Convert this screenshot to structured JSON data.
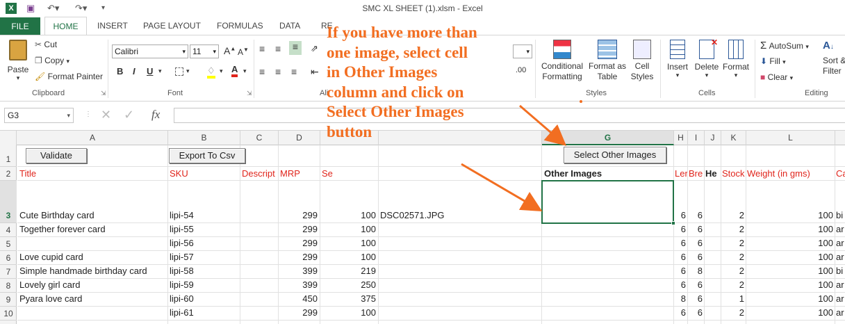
{
  "window": {
    "title": "SMC XL SHEET (1).xlsm - Excel"
  },
  "tabs": [
    "FILE",
    "HOME",
    "INSERT",
    "PAGE LAYOUT",
    "FORMULAS",
    "DATA",
    "RE"
  ],
  "ribbon": {
    "paste": "Paste",
    "cut": "Cut",
    "copy": "Copy",
    "format_painter": "Format Painter",
    "clipboard": "Clipboard",
    "font_name": "Calibri",
    "font_size": "11",
    "font": "Font",
    "alignment": "Ali",
    "conditional_formatting": "Conditional\nFormatting",
    "format_as_table": "Format as\nTable",
    "cell_styles": "Cell\nStyles",
    "styles": "Styles",
    "insert": "Insert",
    "delete": "Delete",
    "format": "Format",
    "cells": "Cells",
    "autosum": "AutoSum",
    "fill": "Fill",
    "clear": "Clear",
    "sort_filter": "Sort &\nFilter",
    "editing": "Editing"
  },
  "formula_bar": {
    "name_box": "G3",
    "fx": "fx",
    "value": ""
  },
  "columns": [
    "A",
    "B",
    "C",
    "D",
    "E",
    "F",
    "G",
    "H",
    "I",
    "J",
    "K",
    "L",
    "M"
  ],
  "column_labels": {
    "A": "A",
    "B": "B",
    "C": "C",
    "D": "D",
    "G": "G",
    "H": "H",
    "I": "I",
    "J": "J",
    "K": "K",
    "L": "L"
  },
  "buttons": {
    "validate": "Validate",
    "export": "Export To Csv",
    "select_other_images": "Select Other Images"
  },
  "headers": {
    "title": "Title",
    "sku": "SKU",
    "description": "Descript",
    "mrp": "MRP",
    "selling": "Se",
    "other_images": "Other Images",
    "length": "Ler",
    "breadth": "Bre",
    "height": "He",
    "stock": "Stock",
    "weight": "Weight (in gms)",
    "category": "Ca"
  },
  "row_numbers": [
    "1",
    "2",
    "3",
    "4",
    "5",
    "6",
    "7",
    "8",
    "9",
    "10"
  ],
  "rows": [
    {
      "title": "Cute Birthday card",
      "sku": "lipi-54",
      "mrp": "299",
      "sp": "100",
      "img": "DSC02571.JPG",
      "h": "6",
      "i": "6",
      "k": "2",
      "l": "100",
      "m": "bi"
    },
    {
      "title": "Together forever card",
      "sku": "lipi-55",
      "mrp": "299",
      "sp": "100",
      "img": "",
      "h": "6",
      "i": "6",
      "k": "2",
      "l": "100",
      "m": "ar"
    },
    {
      "title": "",
      "sku": "lipi-56",
      "mrp": "299",
      "sp": "100",
      "img": "",
      "h": "6",
      "i": "6",
      "k": "2",
      "l": "100",
      "m": "ar"
    },
    {
      "title": "Love cupid card",
      "sku": "lipi-57",
      "mrp": "299",
      "sp": "100",
      "img": "",
      "h": "6",
      "i": "6",
      "k": "2",
      "l": "100",
      "m": "ar"
    },
    {
      "title": "Simple handmade birthday card",
      "sku": "lipi-58",
      "mrp": "399",
      "sp": "219",
      "img": "",
      "h": "6",
      "i": "8",
      "k": "2",
      "l": "100",
      "m": "bi"
    },
    {
      "title": "Lovely girl card",
      "sku": "lipi-59",
      "mrp": "399",
      "sp": "250",
      "img": "",
      "h": "6",
      "i": "6",
      "k": "2",
      "l": "100",
      "m": "ar"
    },
    {
      "title": "Pyara love card",
      "sku": "lipi-60",
      "mrp": "450",
      "sp": "375",
      "img": "",
      "h": "8",
      "i": "6",
      "k": "1",
      "l": "100",
      "m": "ar"
    },
    {
      "title": "",
      "sku": "lipi-61",
      "mrp": "299",
      "sp": "100",
      "img": "",
      "h": "6",
      "i": "6",
      "k": "2",
      "l": "100",
      "m": "ar"
    }
  ],
  "annotation": {
    "lines": [
      "If you have more than",
      "one image, select cell",
      "in Other Images",
      "column and click on",
      "Select Other Images",
      "button"
    ]
  },
  "colors": {
    "accent": "#217346",
    "header_red": "#e0241b",
    "annotation": "#f26e21"
  }
}
